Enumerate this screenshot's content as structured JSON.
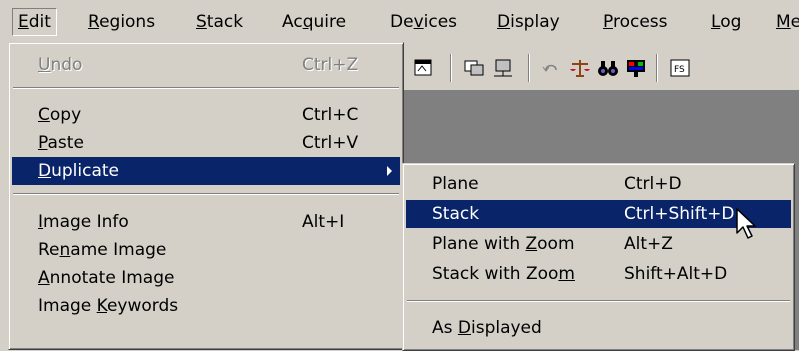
{
  "menubar": {
    "items": [
      {
        "label": "Edit"
      },
      {
        "label": "Regions"
      },
      {
        "label": "Stack"
      },
      {
        "label": "Acquire"
      },
      {
        "label": "Devices"
      },
      {
        "label": "Display"
      },
      {
        "label": "Process"
      },
      {
        "label": "Log"
      },
      {
        "label": "Me"
      }
    ]
  },
  "edit_menu": {
    "undo": {
      "label": "Undo",
      "shortcut": "Ctrl+Z",
      "enabled": false
    },
    "copy": {
      "label": "Copy",
      "shortcut": "Ctrl+C"
    },
    "paste": {
      "label": "Paste",
      "shortcut": "Ctrl+V"
    },
    "duplicate": {
      "label": "Duplicate",
      "highlighted": true
    },
    "image_info": {
      "label": "Image Info",
      "shortcut": "Alt+I"
    },
    "rename_image": {
      "label": "Rename Image"
    },
    "annotate_image": {
      "label": "Annotate Image"
    },
    "image_keywords": {
      "label": "Image Keywords"
    }
  },
  "duplicate_submenu": {
    "plane": {
      "label": "Plane",
      "shortcut": "Ctrl+D"
    },
    "stack": {
      "label": "Stack",
      "shortcut": "Ctrl+Shift+D",
      "highlighted": true
    },
    "plane_zoom": {
      "label": "Plane with Zoom",
      "shortcut": "Alt+Z"
    },
    "stack_zoom": {
      "label": "Stack with Zoom",
      "shortcut": "Shift+Alt+D"
    },
    "as_displayed": {
      "label": "As Displayed"
    }
  },
  "toolbar": {
    "icons": [
      "image-window-icon",
      "region-icon",
      "region-tool-icon",
      "undo-icon",
      "scale-icon",
      "binoculars-icon",
      "palette-icon",
      "fs-icon"
    ]
  },
  "colors": {
    "face": "#d4d0c8",
    "highlight": "#0a246a",
    "client": "#808080"
  }
}
